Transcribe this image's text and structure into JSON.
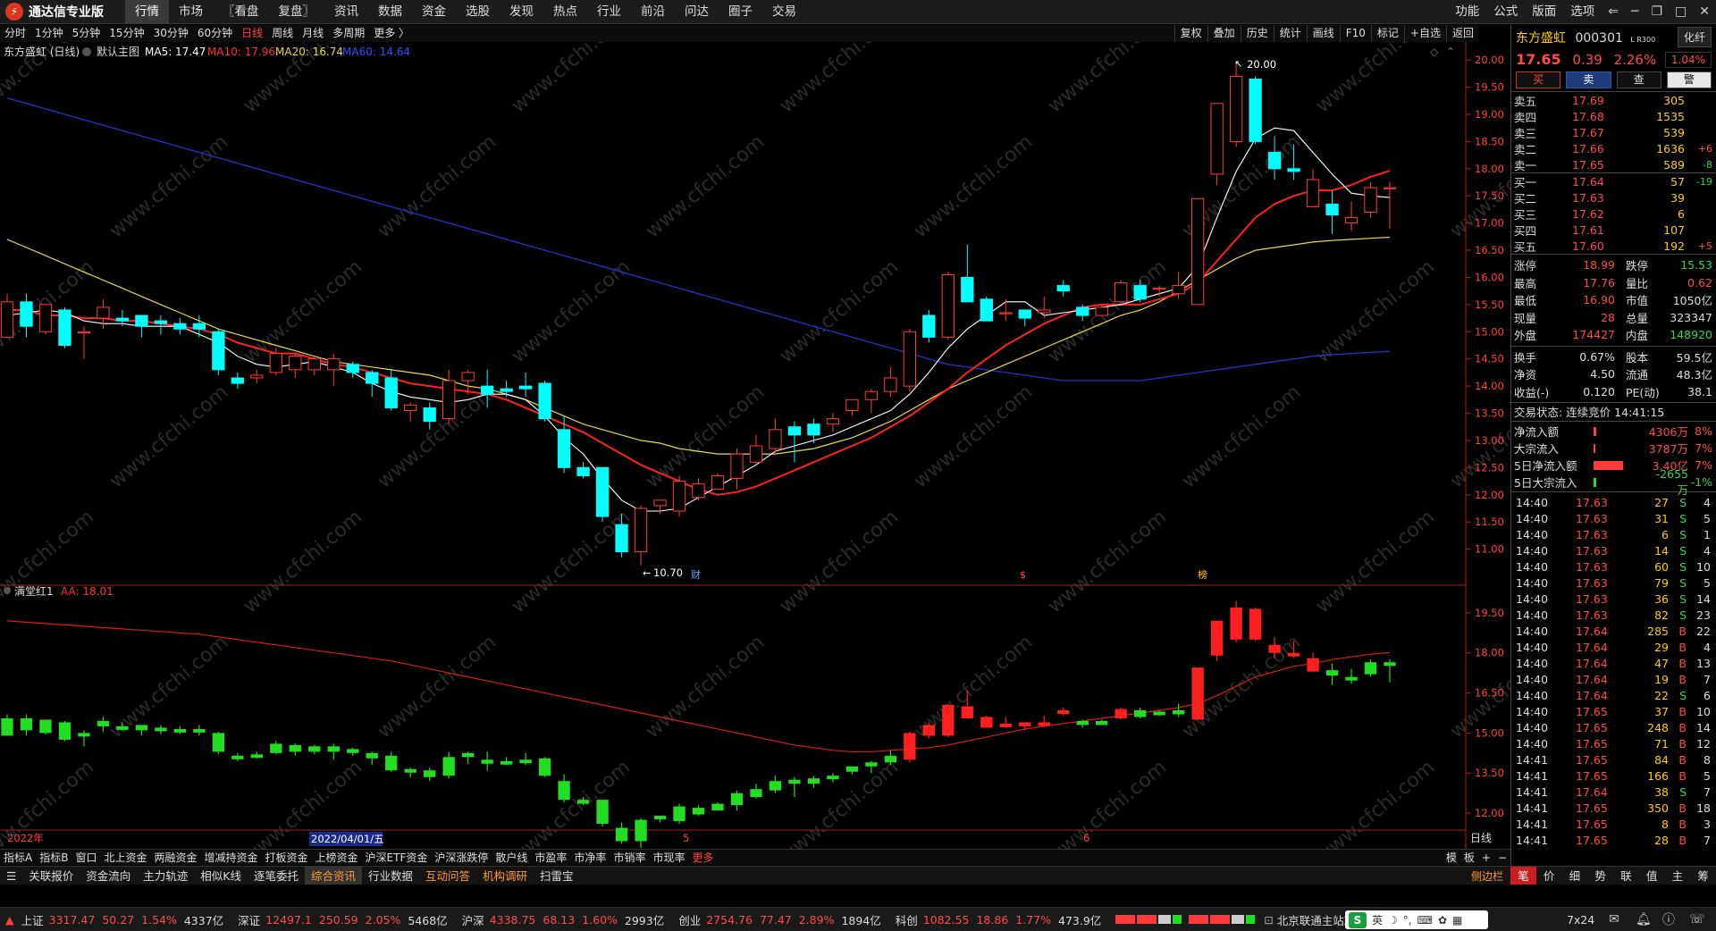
{
  "app": {
    "title": "通达信专业版"
  },
  "menu": [
    "行情",
    "市场",
    "〖看盘",
    "复盘〗",
    "资讯",
    "数据",
    "资金",
    "选股",
    "发现",
    "热点",
    "行业",
    "前沿",
    "问达",
    "圈子",
    "交易"
  ],
  "menu_active": "行情",
  "right_menu": [
    "功能",
    "公式",
    "版面",
    "选项"
  ],
  "periods": [
    "分时",
    "1分钟",
    "5分钟",
    "15分钟",
    "30分钟",
    "60分钟",
    "日线",
    "周线",
    "月线",
    "多周期",
    "更多 〉"
  ],
  "period_active": "日线",
  "tools": [
    "复权",
    "叠加",
    "历史",
    "统计",
    "画线",
    "F10",
    "标记",
    "+自选",
    "返回"
  ],
  "chart_header": {
    "name": "东方盛虹 (日线)",
    "main": "默认主图",
    "ma5": "MA5: 17.47",
    "ma10": "MA10: 17.96",
    "ma20": "MA20: 16.74",
    "ma60": "MA60: 14.64"
  },
  "indicator_header": {
    "name": "满堂红1",
    "aa": "AA: 18.01"
  },
  "annotations": {
    "high": "20.00",
    "low": "10.70",
    "cai": "财",
    "s": "$",
    "bang": "榜"
  },
  "price_axis": [
    "20.00",
    "19.50",
    "19.00",
    "18.50",
    "18.00",
    "17.50",
    "17.00",
    "16.50",
    "16.00",
    "15.50",
    "15.00",
    "14.50",
    "14.00",
    "13.50",
    "13.00",
    "12.50",
    "12.00",
    "11.50",
    "11.00"
  ],
  "ind_axis": [
    "19.50",
    "18.00",
    "16.50",
    "15.00",
    "13.50",
    "12.00"
  ],
  "date_axis": {
    "y2022": "2022年",
    "cursor": "2022/04/01/五",
    "m5": "5",
    "m6": "6",
    "period": "日线"
  },
  "chart_data": {
    "type": "candlestick",
    "ohlc": [
      [
        14.9,
        15.55,
        15.0,
        15.7
      ],
      [
        15.55,
        15.1,
        14.9,
        15.7
      ],
      [
        15.0,
        15.5,
        14.95,
        15.5
      ],
      [
        15.4,
        14.75,
        14.7,
        15.45
      ],
      [
        15.0,
        15.0,
        14.5,
        15.1
      ],
      [
        15.25,
        15.45,
        15.05,
        15.6
      ],
      [
        15.25,
        15.2,
        15.1,
        15.4
      ],
      [
        15.3,
        15.1,
        14.9,
        15.3
      ],
      [
        15.2,
        15.15,
        14.95,
        15.3
      ],
      [
        15.15,
        15.05,
        14.95,
        15.25
      ],
      [
        15.15,
        15.05,
        14.9,
        15.3
      ],
      [
        15.0,
        14.3,
        14.2,
        15.05
      ],
      [
        14.15,
        14.05,
        13.95,
        14.25
      ],
      [
        14.15,
        14.2,
        14.05,
        14.3
      ],
      [
        14.25,
        14.6,
        14.2,
        14.7
      ],
      [
        14.3,
        14.55,
        14.15,
        14.6
      ],
      [
        14.3,
        14.5,
        14.2,
        14.55
      ],
      [
        14.3,
        14.5,
        14.0,
        14.6
      ],
      [
        14.4,
        14.25,
        14.15,
        14.45
      ],
      [
        14.25,
        14.05,
        13.8,
        14.3
      ],
      [
        14.15,
        13.6,
        13.55,
        14.3
      ],
      [
        13.55,
        13.65,
        13.35,
        13.7
      ],
      [
        13.6,
        13.35,
        13.2,
        13.7
      ],
      [
        13.4,
        14.1,
        13.3,
        14.3
      ],
      [
        14.1,
        14.25,
        13.85,
        14.3
      ],
      [
        14.0,
        13.85,
        13.6,
        14.3
      ],
      [
        13.95,
        13.9,
        13.8,
        14.1
      ],
      [
        14.0,
        13.95,
        13.8,
        14.25
      ],
      [
        14.05,
        13.4,
        13.35,
        14.1
      ],
      [
        13.2,
        12.5,
        12.4,
        13.45
      ],
      [
        12.5,
        12.35,
        12.3,
        12.6
      ],
      [
        12.5,
        11.6,
        11.5,
        12.5
      ],
      [
        11.45,
        10.95,
        10.85,
        11.65
      ],
      [
        10.95,
        11.75,
        10.7,
        11.8
      ],
      [
        11.8,
        11.9,
        11.65,
        11.9
      ],
      [
        11.7,
        12.25,
        11.6,
        12.35
      ],
      [
        11.95,
        12.2,
        11.9,
        12.3
      ],
      [
        12.1,
        12.35,
        12.1,
        12.4
      ],
      [
        12.3,
        12.75,
        12.1,
        12.85
      ],
      [
        12.6,
        12.9,
        12.55,
        13.1
      ],
      [
        12.85,
        13.2,
        12.75,
        13.4
      ],
      [
        13.25,
        13.1,
        12.6,
        13.35
      ],
      [
        13.3,
        13.1,
        12.95,
        13.4
      ],
      [
        13.3,
        13.4,
        13.15,
        13.5
      ],
      [
        13.55,
        13.75,
        13.45,
        13.75
      ],
      [
        13.75,
        13.9,
        13.5,
        13.95
      ],
      [
        13.9,
        14.15,
        13.8,
        14.35
      ],
      [
        14.0,
        15.0,
        13.9,
        15.05
      ],
      [
        15.3,
        14.9,
        14.8,
        15.4
      ],
      [
        14.9,
        16.05,
        14.85,
        16.1
      ],
      [
        16.0,
        15.55,
        15.55,
        16.6
      ],
      [
        15.6,
        15.2,
        15.2,
        15.65
      ],
      [
        15.35,
        15.35,
        15.2,
        15.6
      ],
      [
        15.4,
        15.25,
        15.1,
        15.35
      ],
      [
        15.35,
        15.4,
        15.25,
        15.65
      ],
      [
        15.85,
        15.75,
        15.65,
        15.95
      ],
      [
        15.45,
        15.3,
        15.2,
        15.5
      ],
      [
        15.3,
        15.45,
        15.3,
        15.5
      ],
      [
        15.55,
        15.9,
        15.5,
        15.95
      ],
      [
        15.85,
        15.6,
        15.55,
        15.95
      ],
      [
        15.8,
        15.8,
        15.65,
        15.85
      ],
      [
        15.7,
        15.85,
        15.6,
        16.1
      ],
      [
        15.5,
        17.45,
        15.5,
        17.45
      ],
      [
        17.9,
        19.2,
        17.7,
        19.2
      ],
      [
        18.5,
        19.7,
        18.4,
        19.95
      ],
      [
        19.65,
        18.5,
        18.45,
        19.7
      ],
      [
        18.3,
        18.0,
        17.8,
        18.6
      ],
      [
        18.0,
        17.95,
        17.8,
        18.45
      ],
      [
        17.3,
        17.8,
        17.3,
        18.0
      ],
      [
        17.35,
        17.15,
        16.8,
        17.6
      ],
      [
        17.0,
        17.1,
        16.85,
        17.4
      ],
      [
        17.2,
        17.65,
        17.1,
        17.76
      ],
      [
        17.65,
        17.65,
        16.9,
        17.76
      ]
    ],
    "ma5": [
      15.3,
      15.35,
      15.4,
      15.35,
      15.2,
      15.15,
      15.15,
      15.1,
      15.1,
      15.1,
      14.95,
      14.8,
      14.55,
      14.4,
      14.35,
      14.4,
      14.45,
      14.35,
      14.25,
      14.05,
      13.9,
      13.8,
      13.75,
      13.7,
      13.75,
      13.85,
      13.85,
      13.75,
      13.45,
      13.05,
      12.75,
      12.3,
      11.9,
      11.7,
      11.7,
      11.75,
      11.95,
      12.15,
      12.35,
      12.55,
      12.8,
      12.9,
      13.0,
      13.1,
      13.25,
      13.4,
      13.55,
      13.85,
      14.25,
      14.7,
      15.05,
      15.3,
      15.55,
      15.55,
      15.3,
      15.35,
      15.4,
      15.45,
      15.5,
      15.6,
      15.7,
      15.8,
      16.2,
      17.1,
      17.95,
      18.55,
      18.75,
      18.7,
      18.3,
      17.9,
      17.55,
      17.5,
      17.47
    ],
    "ma10": [
      15.4,
      15.4,
      15.3,
      15.3,
      15.25,
      15.25,
      15.2,
      15.2,
      15.15,
      15.1,
      15.05,
      14.95,
      14.8,
      14.7,
      14.6,
      14.6,
      14.5,
      14.4,
      14.35,
      14.25,
      14.15,
      14.05,
      14.0,
      13.95,
      13.9,
      13.85,
      13.75,
      13.6,
      13.45,
      13.3,
      13.15,
      12.95,
      12.75,
      12.55,
      12.4,
      12.25,
      12.1,
      12.0,
      12.05,
      12.15,
      12.3,
      12.45,
      12.6,
      12.75,
      12.9,
      13.05,
      13.25,
      13.45,
      13.7,
      13.95,
      14.25,
      14.5,
      14.75,
      14.95,
      15.15,
      15.3,
      15.45,
      15.5,
      15.5,
      15.5,
      15.6,
      15.7,
      15.9,
      16.3,
      16.7,
      17.1,
      17.35,
      17.5,
      17.6,
      17.6,
      17.7,
      17.85,
      17.96
    ],
    "ma20": [
      16.7,
      16.55,
      16.4,
      16.25,
      16.1,
      15.95,
      15.8,
      15.65,
      15.5,
      15.35,
      15.2,
      15.05,
      14.95,
      14.85,
      14.75,
      14.65,
      14.55,
      14.45,
      14.4,
      14.35,
      14.3,
      14.25,
      14.2,
      14.1,
      14.0,
      13.95,
      13.85,
      13.75,
      13.6,
      13.45,
      13.3,
      13.2,
      13.1,
      13.0,
      12.95,
      12.85,
      12.8,
      12.75,
      12.75,
      12.75,
      12.75,
      12.8,
      12.85,
      12.95,
      13.05,
      13.2,
      13.35,
      13.55,
      13.75,
      13.95,
      14.1,
      14.25,
      14.4,
      14.55,
      14.7,
      14.85,
      15.0,
      15.15,
      15.3,
      15.4,
      15.55,
      15.75,
      15.95,
      16.15,
      16.35,
      16.5,
      16.55,
      16.6,
      16.65,
      16.68,
      16.7,
      16.72,
      16.74
    ],
    "ma60": [
      19.3,
      19.2,
      19.1,
      19.0,
      18.9,
      18.8,
      18.7,
      18.6,
      18.5,
      18.4,
      18.3,
      18.2,
      18.1,
      18.0,
      17.9,
      17.8,
      17.7,
      17.6,
      17.5,
      17.4,
      17.3,
      17.2,
      17.1,
      17.0,
      16.9,
      16.8,
      16.7,
      16.6,
      16.5,
      16.4,
      16.3,
      16.2,
      16.1,
      16.0,
      15.9,
      15.8,
      15.7,
      15.6,
      15.5,
      15.4,
      15.3,
      15.2,
      15.1,
      15.0,
      14.9,
      14.8,
      14.7,
      14.6,
      14.5,
      14.4,
      14.35,
      14.3,
      14.25,
      14.2,
      14.15,
      14.1,
      14.1,
      14.1,
      14.1,
      14.1,
      14.15,
      14.2,
      14.25,
      14.3,
      14.35,
      14.4,
      14.45,
      14.5,
      14.55,
      14.58,
      14.6,
      14.62,
      14.64
    ],
    "aa": [
      19.2,
      19.15,
      19.1,
      19.05,
      19.0,
      18.95,
      18.9,
      18.85,
      18.8,
      18.75,
      18.7,
      18.6,
      18.5,
      18.4,
      18.3,
      18.2,
      18.1,
      18.0,
      17.9,
      17.8,
      17.7,
      17.55,
      17.4,
      17.25,
      17.1,
      16.95,
      16.8,
      16.65,
      16.5,
      16.35,
      16.2,
      16.05,
      15.9,
      15.75,
      15.6,
      15.45,
      15.3,
      15.15,
      15.0,
      14.85,
      14.7,
      14.55,
      14.45,
      14.35,
      14.3,
      14.3,
      14.35,
      14.4,
      14.45,
      14.55,
      14.7,
      14.85,
      15.0,
      15.15,
      15.25,
      15.35,
      15.45,
      15.55,
      15.65,
      15.75,
      15.85,
      15.95,
      16.1,
      16.4,
      16.75,
      17.1,
      17.3,
      17.5,
      17.6,
      17.75,
      17.85,
      17.95,
      18.01
    ],
    "ylim": [
      10.5,
      20.2
    ],
    "ind_ylim": [
      11.5,
      20.2
    ]
  },
  "quote": {
    "name": "东方盛虹",
    "code": "000301",
    "tag": "L R300",
    "view_btn": "化纤",
    "price": "17.65",
    "change": "0.39",
    "pct": "2.26%",
    "weibi": "1.04%",
    "actions": [
      "买",
      "卖",
      "查",
      "警"
    ],
    "asks": [
      {
        "label": "卖五",
        "price": "17.69",
        "vol": "305",
        "chg": ""
      },
      {
        "label": "卖四",
        "price": "17.68",
        "vol": "1535",
        "chg": ""
      },
      {
        "label": "卖三",
        "price": "17.67",
        "vol": "539",
        "chg": ""
      },
      {
        "label": "卖二",
        "price": "17.66",
        "vol": "1636",
        "chg": "+6"
      },
      {
        "label": "卖一",
        "price": "17.65",
        "vol": "589",
        "chg": "-8"
      }
    ],
    "bids": [
      {
        "label": "买一",
        "price": "17.64",
        "vol": "57",
        "chg": "-19"
      },
      {
        "label": "买二",
        "price": "17.63",
        "vol": "39",
        "chg": ""
      },
      {
        "label": "买三",
        "price": "17.62",
        "vol": "6",
        "chg": ""
      },
      {
        "label": "买四",
        "price": "17.61",
        "vol": "107",
        "chg": ""
      },
      {
        "label": "买五",
        "price": "17.60",
        "vol": "192",
        "chg": "+5"
      }
    ],
    "stats": [
      {
        "k": "涨停",
        "v": "18.99",
        "k2": "跌停",
        "v2": "15.53"
      },
      {
        "k": "最高",
        "v": "17.76",
        "k2": "量比",
        "v2": "0.62"
      },
      {
        "k": "最低",
        "v": "16.90",
        "k2": "市值",
        "v2": "1050亿"
      },
      {
        "k": "现量",
        "v": "28",
        "k2": "总量",
        "v2": "323347"
      },
      {
        "k": "外盘",
        "v": "174427",
        "k2": "内盘",
        "v2": "148920"
      }
    ],
    "stats2": [
      {
        "k": "换手",
        "v": "0.67%",
        "k2": "股本",
        "v2": "59.5亿"
      },
      {
        "k": "净资",
        "v": "4.50",
        "k2": "流通",
        "v2": "48.3亿"
      },
      {
        "k": "收益(-)",
        "v": "0.120",
        "k2": "PE(动)",
        "v2": "38.1"
      }
    ],
    "trade_state": "交易状态: 连续竞价 14:41:15",
    "flows": [
      {
        "k": "净流入额",
        "v": "4306万",
        "pct": "8%",
        "dir": "in",
        "level": 0.05
      },
      {
        "k": "大宗流入",
        "v": "3787万",
        "pct": "7%",
        "dir": "in",
        "level": 0.04
      },
      {
        "k": "5日净流入额",
        "v": "3.40亿",
        "pct": "7%",
        "dir": "in",
        "level": 0.55
      },
      {
        "k": "5日大宗流入",
        "v": "-2655万",
        "pct": "-1%",
        "dir": "out",
        "level": 0.05
      }
    ],
    "ticks": [
      {
        "t": "14:40",
        "p": "17.63",
        "v": "27",
        "bs": "S",
        "n": "4"
      },
      {
        "t": "14:40",
        "p": "17.63",
        "v": "31",
        "bs": "S",
        "n": "5"
      },
      {
        "t": "14:40",
        "p": "17.63",
        "v": "6",
        "bs": "S",
        "n": "1"
      },
      {
        "t": "14:40",
        "p": "17.63",
        "v": "14",
        "bs": "S",
        "n": "4"
      },
      {
        "t": "14:40",
        "p": "17.63",
        "v": "60",
        "bs": "S",
        "n": "10"
      },
      {
        "t": "14:40",
        "p": "17.63",
        "v": "79",
        "bs": "S",
        "n": "5"
      },
      {
        "t": "14:40",
        "p": "17.63",
        "v": "36",
        "bs": "S",
        "n": "14"
      },
      {
        "t": "14:40",
        "p": "17.63",
        "v": "82",
        "bs": "S",
        "n": "23"
      },
      {
        "t": "14:40",
        "p": "17.64",
        "v": "285",
        "bs": "B",
        "n": "22"
      },
      {
        "t": "14:40",
        "p": "17.64",
        "v": "29",
        "bs": "B",
        "n": "4"
      },
      {
        "t": "14:40",
        "p": "17.64",
        "v": "47",
        "bs": "B",
        "n": "13"
      },
      {
        "t": "14:40",
        "p": "17.64",
        "v": "19",
        "bs": "B",
        "n": "7"
      },
      {
        "t": "14:40",
        "p": "17.64",
        "v": "22",
        "bs": "S",
        "n": "6"
      },
      {
        "t": "14:40",
        "p": "17.65",
        "v": "37",
        "bs": "B",
        "n": "10"
      },
      {
        "t": "14:40",
        "p": "17.65",
        "v": "248",
        "bs": "B",
        "n": "14"
      },
      {
        "t": "14:40",
        "p": "17.65",
        "v": "71",
        "bs": "B",
        "n": "12"
      },
      {
        "t": "14:41",
        "p": "17.65",
        "v": "84",
        "bs": "B",
        "n": "8"
      },
      {
        "t": "14:41",
        "p": "17.65",
        "v": "166",
        "bs": "B",
        "n": "5"
      },
      {
        "t": "14:41",
        "p": "17.64",
        "v": "38",
        "bs": "S",
        "n": "7"
      },
      {
        "t": "14:41",
        "p": "17.65",
        "v": "350",
        "bs": "B",
        "n": "18"
      },
      {
        "t": "14:41",
        "p": "17.65",
        "v": "8",
        "bs": "B",
        "n": "3"
      },
      {
        "t": "14:41",
        "p": "17.65",
        "v": "28",
        "bs": "B",
        "n": "7"
      }
    ],
    "tabs": [
      "笔",
      "价",
      "细",
      "势",
      "联",
      "值",
      "主",
      "筹"
    ],
    "tab_active": "笔"
  },
  "bottom_tabs1": [
    "指标A",
    "指标B",
    "窗口",
    "北上资金",
    "两融资金",
    "增减持资金",
    "打板资金",
    "上榜资金",
    "沪深ETF资金",
    "沪深涨跌停",
    "散户线",
    "市盈率",
    "市净率",
    "市销率",
    "市现率",
    "更多"
  ],
  "bottom_tabs1_right": [
    "模",
    "板",
    "+",
    "−"
  ],
  "bottom_tabs2": [
    "关联报价",
    "资金流向",
    "主力轨迹",
    "相似K线",
    "逐笔委托",
    "综合资讯",
    "行业数据",
    "互动问答",
    "机构调研",
    "扫雷宝"
  ],
  "bottom_tabs2_active": "综合资讯",
  "sidebar_label": "侧边栏",
  "status": {
    "sh": {
      "name": "上证",
      "v": "3317.47",
      "c": "50.27",
      "p": "1.54%",
      "a": "4337亿"
    },
    "sz": {
      "name": "深证",
      "v": "12497.1",
      "c": "250.59",
      "p": "2.05%",
      "a": "5468亿"
    },
    "hs": {
      "name": "沪深",
      "v": "4338.75",
      "c": "68.13",
      "p": "1.60%",
      "a": "2993亿"
    },
    "cy": {
      "name": "创业",
      "v": "2754.76",
      "c": "77.47",
      "p": "2.89%",
      "a": "1894亿"
    },
    "kc": {
      "name": "科创",
      "v": "1082.55",
      "c": "18.86",
      "p": "1.77%",
      "a": "473.9亿"
    },
    "server": "北京联通主站Z2",
    "ime": "英",
    "clock": "7x24"
  },
  "colors": {
    "up": "#ff3b3b",
    "down": "#00ffff",
    "ma5": "#ffffff",
    "ma10": "#ff2020",
    "ma20": "#e5d84a",
    "ma60": "#2035d0",
    "ind_up": "#ff1f1f",
    "ind_down": "#22dd22"
  }
}
